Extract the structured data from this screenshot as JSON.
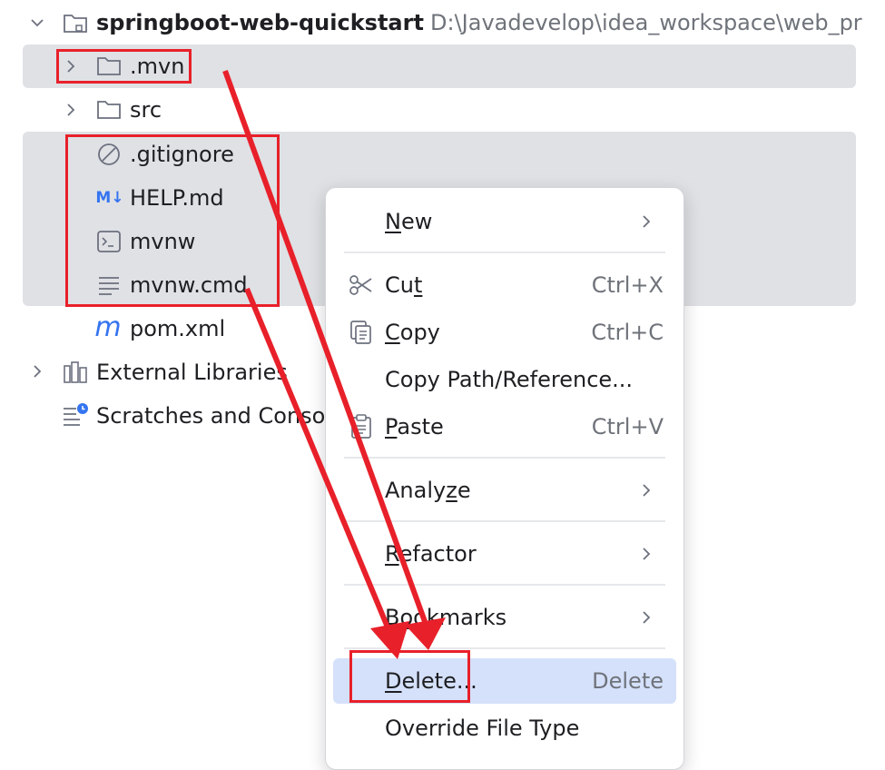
{
  "tree": {
    "root": {
      "name": "springboot-web-quickstart",
      "path": "D:\\Javadevelop\\idea_workspace\\web_pr"
    },
    "items": [
      {
        "label": ".mvn",
        "icon": "folder-icon"
      },
      {
        "label": "src",
        "icon": "folder-icon"
      },
      {
        "label": ".gitignore",
        "icon": "ignore-file-icon"
      },
      {
        "label": "HELP.md",
        "icon": "markdown-icon",
        "icon_text": "M↓"
      },
      {
        "label": "mvnw",
        "icon": "terminal-script-icon"
      },
      {
        "label": "mvnw.cmd",
        "icon": "text-file-icon"
      },
      {
        "label": "pom.xml",
        "icon": "maven-icon",
        "icon_text": "m"
      }
    ],
    "external": "External Libraries",
    "scratches": "Scratches and Conso"
  },
  "menu": {
    "new": {
      "pre": "",
      "u": "N",
      "post": "ew"
    },
    "cut": {
      "pre": "Cu",
      "u": "t",
      "post": "",
      "shortcut": "Ctrl+X"
    },
    "copy": {
      "pre": "",
      "u": "C",
      "post": "opy",
      "shortcut": "Ctrl+C"
    },
    "copy_path": "Copy Path/Reference...",
    "paste": {
      "pre": "",
      "u": "P",
      "post": "aste",
      "shortcut": "Ctrl+V"
    },
    "analyze": {
      "pre": "Analy",
      "u": "z",
      "post": "e"
    },
    "refactor": {
      "pre": "",
      "u": "R",
      "post": "efactor"
    },
    "bookmarks": {
      "pre": "B",
      "u": "o",
      "post": "okmarks"
    },
    "delete": {
      "pre": "",
      "u": "D",
      "post": "elete...",
      "shortcut": "Delete"
    },
    "override": "Override File Type"
  },
  "colors": {
    "selection": "#dfe1e5",
    "menu_highlight": "#d5e1fb",
    "annotation": "#e8202a",
    "accent": "#3574f0"
  }
}
